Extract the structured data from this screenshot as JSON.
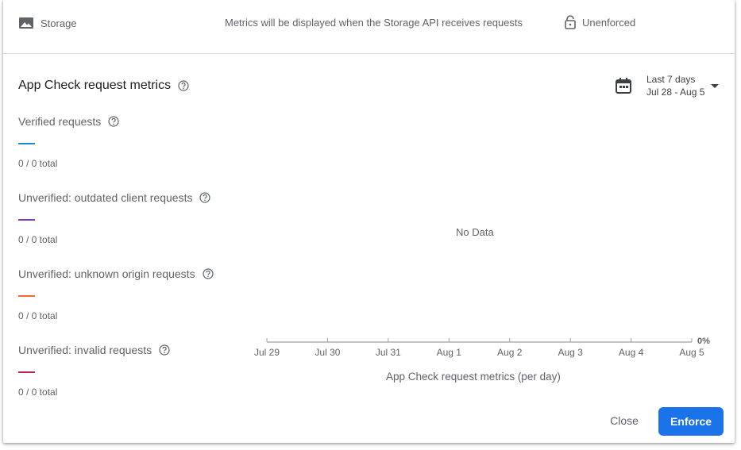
{
  "service_row": {
    "service_name": "Storage",
    "metrics_message": "Metrics will be displayed when the Storage API receives requests",
    "status": "Unenforced"
  },
  "section": {
    "title": "App Check request metrics"
  },
  "date_range": {
    "label": "Last 7 days",
    "range": "Jul 28 - Aug 5"
  },
  "metrics": [
    {
      "label": "Verified requests",
      "total": "0 / 0 total",
      "color": "#1e88c8"
    },
    {
      "label": "Unverified: outdated client requests",
      "total": "0 / 0 total",
      "color": "#7b3fa5"
    },
    {
      "label": "Unverified: unknown origin requests",
      "total": "0 / 0 total",
      "color": "#f06a3b"
    },
    {
      "label": "Unverified: invalid requests",
      "total": "0 / 0 total",
      "color": "#b3245e"
    }
  ],
  "chart": {
    "no_data": "No Data",
    "caption": "App Check request metrics (per day)"
  },
  "chart_data": {
    "type": "line",
    "categories": [
      "Jul 29",
      "Jul 30",
      "Jul 31",
      "Aug 1",
      "Aug 2",
      "Aug 3",
      "Aug 4",
      "Aug 5"
    ],
    "y_tick_label": "0%",
    "series": []
  },
  "actions": {
    "close_label": "Close",
    "enforce_label": "Enforce"
  },
  "colors": {
    "accent": "#1a73e8"
  }
}
